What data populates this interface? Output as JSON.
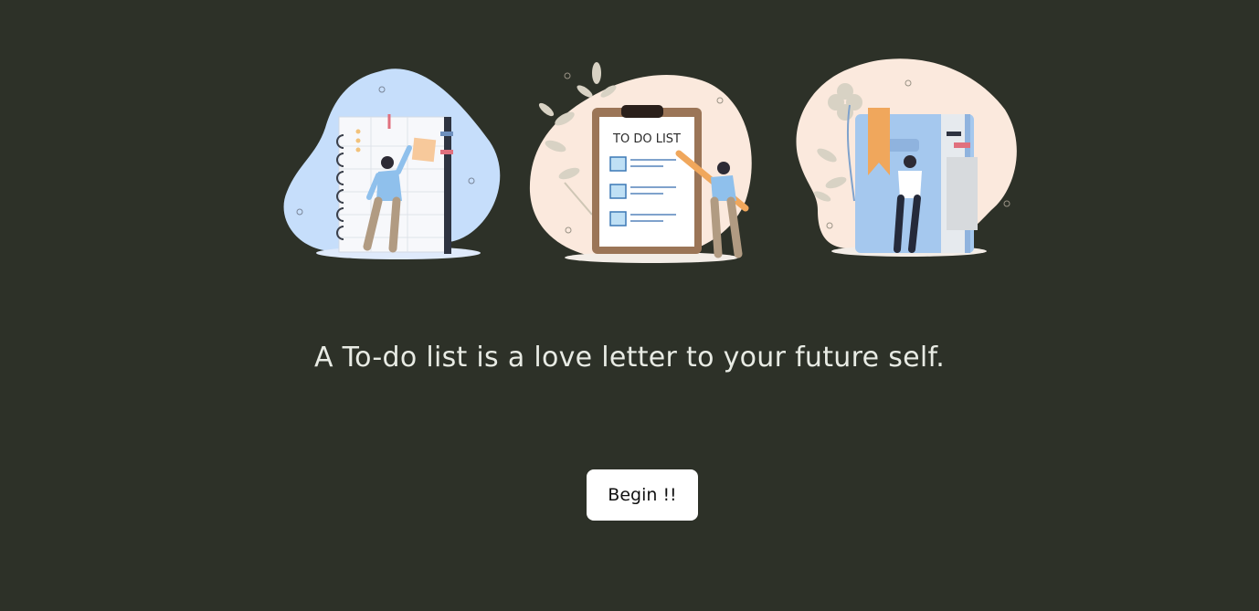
{
  "illustrations": {
    "clipboard_heading": "TO DO LIST"
  },
  "quote": "A To-do list is a love letter to your future self.",
  "begin_button": "Begin !!",
  "colors": {
    "background": "#2d3128",
    "text": "#e8ebe4",
    "button_bg": "#ffffff"
  }
}
